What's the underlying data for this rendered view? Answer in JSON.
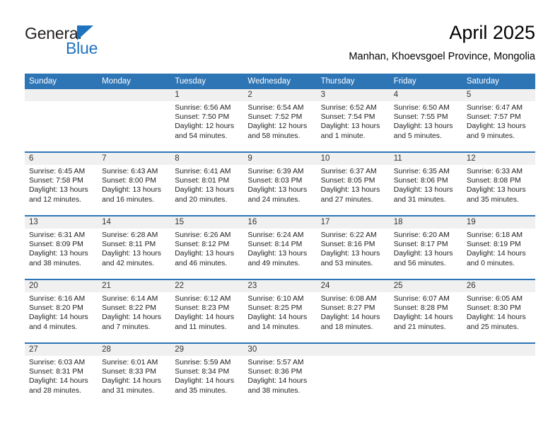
{
  "brand": {
    "name_top": "General",
    "name_bottom": "Blue",
    "triangle_icon": "blue-triangle-icon",
    "accent_color": "#1f72bd"
  },
  "header": {
    "title": "April 2025",
    "subtitle": "Manhan, Khoevsgoel Province, Mongolia"
  },
  "calendar": {
    "header_color": "#2e75b6",
    "daynum_band_color": "#f0f0f0",
    "weekday_headers": [
      "Sunday",
      "Monday",
      "Tuesday",
      "Wednesday",
      "Thursday",
      "Friday",
      "Saturday"
    ],
    "labels": {
      "sunrise": "Sunrise:",
      "sunset": "Sunset:",
      "daylight": "Daylight:"
    },
    "weeks": [
      [
        {
          "day": ""
        },
        {
          "day": ""
        },
        {
          "day": "1",
          "sunrise": "Sunrise: 6:56 AM",
          "sunset": "Sunset: 7:50 PM",
          "daylight1": "Daylight: 12 hours",
          "daylight2": "and 54 minutes."
        },
        {
          "day": "2",
          "sunrise": "Sunrise: 6:54 AM",
          "sunset": "Sunset: 7:52 PM",
          "daylight1": "Daylight: 12 hours",
          "daylight2": "and 58 minutes."
        },
        {
          "day": "3",
          "sunrise": "Sunrise: 6:52 AM",
          "sunset": "Sunset: 7:54 PM",
          "daylight1": "Daylight: 13 hours",
          "daylight2": "and 1 minute."
        },
        {
          "day": "4",
          "sunrise": "Sunrise: 6:50 AM",
          "sunset": "Sunset: 7:55 PM",
          "daylight1": "Daylight: 13 hours",
          "daylight2": "and 5 minutes."
        },
        {
          "day": "5",
          "sunrise": "Sunrise: 6:47 AM",
          "sunset": "Sunset: 7:57 PM",
          "daylight1": "Daylight: 13 hours",
          "daylight2": "and 9 minutes."
        }
      ],
      [
        {
          "day": "6",
          "sunrise": "Sunrise: 6:45 AM",
          "sunset": "Sunset: 7:58 PM",
          "daylight1": "Daylight: 13 hours",
          "daylight2": "and 12 minutes."
        },
        {
          "day": "7",
          "sunrise": "Sunrise: 6:43 AM",
          "sunset": "Sunset: 8:00 PM",
          "daylight1": "Daylight: 13 hours",
          "daylight2": "and 16 minutes."
        },
        {
          "day": "8",
          "sunrise": "Sunrise: 6:41 AM",
          "sunset": "Sunset: 8:01 PM",
          "daylight1": "Daylight: 13 hours",
          "daylight2": "and 20 minutes."
        },
        {
          "day": "9",
          "sunrise": "Sunrise: 6:39 AM",
          "sunset": "Sunset: 8:03 PM",
          "daylight1": "Daylight: 13 hours",
          "daylight2": "and 24 minutes."
        },
        {
          "day": "10",
          "sunrise": "Sunrise: 6:37 AM",
          "sunset": "Sunset: 8:05 PM",
          "daylight1": "Daylight: 13 hours",
          "daylight2": "and 27 minutes."
        },
        {
          "day": "11",
          "sunrise": "Sunrise: 6:35 AM",
          "sunset": "Sunset: 8:06 PM",
          "daylight1": "Daylight: 13 hours",
          "daylight2": "and 31 minutes."
        },
        {
          "day": "12",
          "sunrise": "Sunrise: 6:33 AM",
          "sunset": "Sunset: 8:08 PM",
          "daylight1": "Daylight: 13 hours",
          "daylight2": "and 35 minutes."
        }
      ],
      [
        {
          "day": "13",
          "sunrise": "Sunrise: 6:31 AM",
          "sunset": "Sunset: 8:09 PM",
          "daylight1": "Daylight: 13 hours",
          "daylight2": "and 38 minutes."
        },
        {
          "day": "14",
          "sunrise": "Sunrise: 6:28 AM",
          "sunset": "Sunset: 8:11 PM",
          "daylight1": "Daylight: 13 hours",
          "daylight2": "and 42 minutes."
        },
        {
          "day": "15",
          "sunrise": "Sunrise: 6:26 AM",
          "sunset": "Sunset: 8:12 PM",
          "daylight1": "Daylight: 13 hours",
          "daylight2": "and 46 minutes."
        },
        {
          "day": "16",
          "sunrise": "Sunrise: 6:24 AM",
          "sunset": "Sunset: 8:14 PM",
          "daylight1": "Daylight: 13 hours",
          "daylight2": "and 49 minutes."
        },
        {
          "day": "17",
          "sunrise": "Sunrise: 6:22 AM",
          "sunset": "Sunset: 8:16 PM",
          "daylight1": "Daylight: 13 hours",
          "daylight2": "and 53 minutes."
        },
        {
          "day": "18",
          "sunrise": "Sunrise: 6:20 AM",
          "sunset": "Sunset: 8:17 PM",
          "daylight1": "Daylight: 13 hours",
          "daylight2": "and 56 minutes."
        },
        {
          "day": "19",
          "sunrise": "Sunrise: 6:18 AM",
          "sunset": "Sunset: 8:19 PM",
          "daylight1": "Daylight: 14 hours",
          "daylight2": "and 0 minutes."
        }
      ],
      [
        {
          "day": "20",
          "sunrise": "Sunrise: 6:16 AM",
          "sunset": "Sunset: 8:20 PM",
          "daylight1": "Daylight: 14 hours",
          "daylight2": "and 4 minutes."
        },
        {
          "day": "21",
          "sunrise": "Sunrise: 6:14 AM",
          "sunset": "Sunset: 8:22 PM",
          "daylight1": "Daylight: 14 hours",
          "daylight2": "and 7 minutes."
        },
        {
          "day": "22",
          "sunrise": "Sunrise: 6:12 AM",
          "sunset": "Sunset: 8:23 PM",
          "daylight1": "Daylight: 14 hours",
          "daylight2": "and 11 minutes."
        },
        {
          "day": "23",
          "sunrise": "Sunrise: 6:10 AM",
          "sunset": "Sunset: 8:25 PM",
          "daylight1": "Daylight: 14 hours",
          "daylight2": "and 14 minutes."
        },
        {
          "day": "24",
          "sunrise": "Sunrise: 6:08 AM",
          "sunset": "Sunset: 8:27 PM",
          "daylight1": "Daylight: 14 hours",
          "daylight2": "and 18 minutes."
        },
        {
          "day": "25",
          "sunrise": "Sunrise: 6:07 AM",
          "sunset": "Sunset: 8:28 PM",
          "daylight1": "Daylight: 14 hours",
          "daylight2": "and 21 minutes."
        },
        {
          "day": "26",
          "sunrise": "Sunrise: 6:05 AM",
          "sunset": "Sunset: 8:30 PM",
          "daylight1": "Daylight: 14 hours",
          "daylight2": "and 25 minutes."
        }
      ],
      [
        {
          "day": "27",
          "sunrise": "Sunrise: 6:03 AM",
          "sunset": "Sunset: 8:31 PM",
          "daylight1": "Daylight: 14 hours",
          "daylight2": "and 28 minutes."
        },
        {
          "day": "28",
          "sunrise": "Sunrise: 6:01 AM",
          "sunset": "Sunset: 8:33 PM",
          "daylight1": "Daylight: 14 hours",
          "daylight2": "and 31 minutes."
        },
        {
          "day": "29",
          "sunrise": "Sunrise: 5:59 AM",
          "sunset": "Sunset: 8:34 PM",
          "daylight1": "Daylight: 14 hours",
          "daylight2": "and 35 minutes."
        },
        {
          "day": "30",
          "sunrise": "Sunrise: 5:57 AM",
          "sunset": "Sunset: 8:36 PM",
          "daylight1": "Daylight: 14 hours",
          "daylight2": "and 38 minutes."
        },
        {
          "day": ""
        },
        {
          "day": ""
        },
        {
          "day": ""
        }
      ]
    ]
  }
}
